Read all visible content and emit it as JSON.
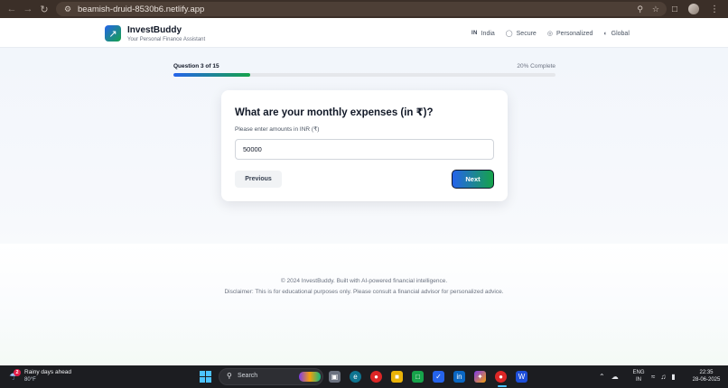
{
  "browser": {
    "url": "beamish-druid-8530b6.netlify.app"
  },
  "header": {
    "brand": "InvestBuddy",
    "tagline": "Your Personal Finance Assistant",
    "nav": [
      {
        "icon": "flag-icon",
        "flag_text": "IN",
        "label": "India"
      },
      {
        "icon": "shield-icon",
        "label": "Secure"
      },
      {
        "icon": "target-icon",
        "label": "Personalized"
      },
      {
        "icon": "globe-icon",
        "label": "Global"
      }
    ]
  },
  "progress": {
    "label": "Question 3 of 15",
    "percent_text": "20% Complete",
    "fraction": 0.2
  },
  "question": {
    "title": "What are your monthly expenses (in ₹)?",
    "hint": "Please enter amounts in INR (₹)",
    "value": "50000",
    "prev_label": "Previous",
    "next_label": "Next"
  },
  "footer": {
    "copyright": "© 2024 InvestBuddy. Built with AI-powered financial intelligence.",
    "disclaimer": "Disclaimer: This is for educational purposes only. Please consult a financial advisor for personalized advice."
  },
  "taskbar": {
    "weather_badge": "2",
    "weather_title": "Rainy days ahead",
    "weather_temp": "80°F",
    "search_label": "Search",
    "lang_line1": "ENG",
    "lang_line2": "IN",
    "time": "22:35",
    "date": "28-06-2025"
  },
  "colors": {
    "accent_blue": "#2563eb",
    "accent_green": "#16a34a",
    "browser_chrome": "#3b2f28",
    "taskbar": "#1c1d21"
  }
}
